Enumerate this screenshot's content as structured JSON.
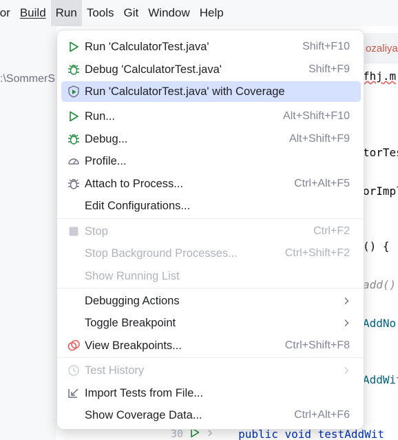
{
  "menubar": {
    "items": [
      "tor",
      "Build",
      "Run",
      "Tools",
      "Git",
      "Window",
      "Help"
    ],
    "mnemonics": [
      "",
      "B",
      "u",
      "T",
      "G",
      "W",
      "H"
    ]
  },
  "background": {
    "path_text": ":\\SommerS",
    "tab_text": "ozaliya",
    "code_lines": [
      "fhj.m",
      "torTes",
      "orImpl",
      "() {",
      "add()",
      "AddNor",
      "AddWit"
    ],
    "bottom_line_number": "30",
    "bottom_code": "public void testAddWit"
  },
  "menu": {
    "items": [
      {
        "label": "Run 'CalculatorTest.java'",
        "shortcut": "Shift+F10",
        "icon": "run-icon"
      },
      {
        "label": "Debug 'CalculatorTest.java'",
        "shortcut": "Shift+F9",
        "icon": "debug-icon"
      },
      {
        "label": "Run 'CalculatorTest.java' with Coverage",
        "shortcut": "",
        "icon": "coverage-icon"
      },
      {
        "label": "Run...",
        "shortcut": "Alt+Shift+F10",
        "icon": "run-icon"
      },
      {
        "label": "Debug...",
        "shortcut": "Alt+Shift+F9",
        "icon": "debug-icon"
      },
      {
        "label": "Profile...",
        "shortcut": "",
        "icon": "profile-icon"
      },
      {
        "label": "Attach to Process...",
        "shortcut": "Ctrl+Alt+F5",
        "icon": "attach-icon"
      },
      {
        "label": "Edit Configurations...",
        "shortcut": "",
        "icon": ""
      },
      {
        "label": "Stop",
        "shortcut": "Ctrl+F2",
        "icon": "stop-icon"
      },
      {
        "label": "Stop Background Processes...",
        "shortcut": "Ctrl+Shift+F2",
        "icon": ""
      },
      {
        "label": "Show Running List",
        "shortcut": "",
        "icon": ""
      },
      {
        "label": "Debugging Actions",
        "shortcut": "",
        "icon": ""
      },
      {
        "label": "Toggle Breakpoint",
        "shortcut": "",
        "icon": ""
      },
      {
        "label": "View Breakpoints...",
        "shortcut": "Ctrl+Shift+F8",
        "icon": "breakpoints-icon"
      },
      {
        "label": "Test History",
        "shortcut": "",
        "icon": "history-icon"
      },
      {
        "label": "Import Tests from File...",
        "shortcut": "",
        "icon": "import-icon"
      },
      {
        "label": "Show Coverage Data...",
        "shortcut": "Ctrl+Alt+F6",
        "icon": ""
      }
    ],
    "selected_item": "Run 'CalculatorTest.java' with Coverage",
    "disabled_items": [
      "Stop",
      "Stop Background Processes...",
      "Show Running List",
      "Test History"
    ]
  },
  "colors": {
    "run_green": "#208a3c",
    "selection": "#d5e1ff",
    "breakpoint_red": "#e55d5d",
    "icon_gray": "#6c707e"
  }
}
